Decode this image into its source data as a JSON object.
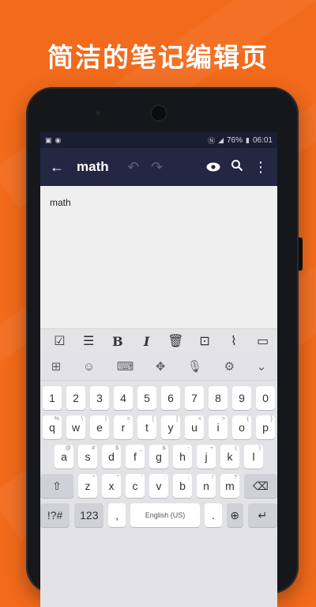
{
  "headline": "简洁的笔记编辑页",
  "status": {
    "battery": "76%",
    "time": "06:01"
  },
  "appbar": {
    "title": "math"
  },
  "editor": {
    "content": "math"
  },
  "keyboard": {
    "numbers": [
      "1",
      "2",
      "3",
      "4",
      "5",
      "6",
      "7",
      "8",
      "9",
      "0"
    ],
    "row1": [
      {
        "k": "q",
        "s": "%"
      },
      {
        "k": "w",
        "s": "\\"
      },
      {
        "k": "e",
        "s": "|"
      },
      {
        "k": "r",
        "s": "="
      },
      {
        "k": "t",
        "s": "["
      },
      {
        "k": "y",
        "s": "]"
      },
      {
        "k": "u",
        "s": "<"
      },
      {
        "k": "i",
        "s": ">"
      },
      {
        "k": "o",
        "s": "{"
      },
      {
        "k": "p",
        "s": "}"
      }
    ],
    "row2": [
      {
        "k": "a",
        "s": "@"
      },
      {
        "k": "s",
        "s": "#"
      },
      {
        "k": "d",
        "s": "$"
      },
      {
        "k": "f",
        "s": "_"
      },
      {
        "k": "g",
        "s": "&"
      },
      {
        "k": "h",
        "s": "-"
      },
      {
        "k": "j",
        "s": "+"
      },
      {
        "k": "k",
        "s": "("
      },
      {
        "k": "l",
        "s": ")"
      }
    ],
    "row3": [
      {
        "k": "z",
        "s": "*"
      },
      {
        "k": "x",
        "s": "\""
      },
      {
        "k": "c",
        "s": "'"
      },
      {
        "k": "v",
        "s": ":"
      },
      {
        "k": "b",
        "s": ";"
      },
      {
        "k": "n",
        "s": "!"
      },
      {
        "k": "m",
        "s": "?"
      }
    ],
    "symbols_label": "!?#",
    "numpad_label": "123",
    "comma": ",",
    "space_label": "English (US)",
    "period": "."
  },
  "icons": {
    "back": "back-arrow-icon",
    "undo": "undo-icon",
    "redo": "redo-icon",
    "preview": "eye-icon",
    "search": "search-icon",
    "more": "more-vert-icon"
  },
  "colors": {
    "background": "#f26a1b",
    "appbar": "#232742",
    "statusbar": "#1b1d33"
  }
}
